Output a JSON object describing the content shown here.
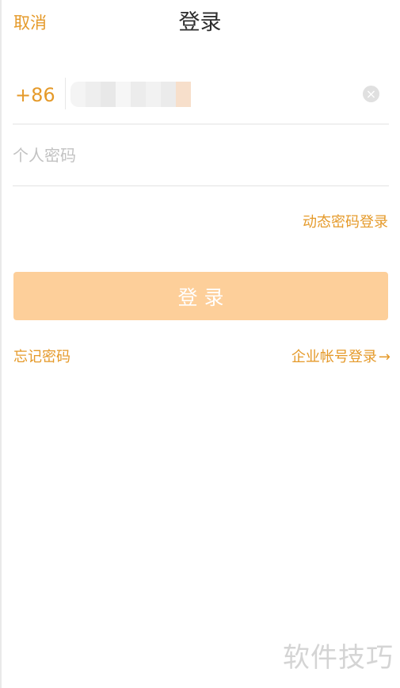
{
  "header": {
    "cancel_label": "取消",
    "title": "登录"
  },
  "phone": {
    "country_code": "+86",
    "value": "",
    "clear_icon": "clear-circle-icon"
  },
  "password": {
    "placeholder": "个人密码"
  },
  "links": {
    "dynamic_login": "动态密码登录",
    "forgot_password": "忘记密码",
    "enterprise_login": "企业帐号登录",
    "arrow_glyph": "→"
  },
  "login_button": {
    "label": "登录"
  },
  "watermark": {
    "text": "软件技巧"
  },
  "colors": {
    "accent": "#e59a2a",
    "button_disabled": "#fdcf9a",
    "title_text": "#2d2d2d",
    "placeholder": "#c2c2c2",
    "divider": "#e3e3e3"
  }
}
